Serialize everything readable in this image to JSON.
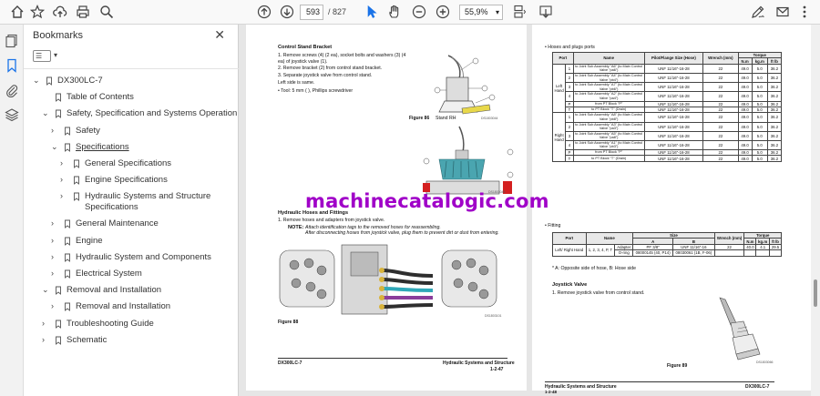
{
  "toolbar": {
    "current_page": "593",
    "total_pages": "/ 827",
    "zoom": "55,9%"
  },
  "bookmarks": {
    "title": "Bookmarks",
    "items": [
      {
        "label": "DX300LC-7",
        "indent": 0,
        "chev": "v"
      },
      {
        "label": "Table of Contents",
        "indent": 1,
        "chev": ""
      },
      {
        "label": "Safety, Specification and Systems Operation",
        "indent": 1,
        "chev": "v"
      },
      {
        "label": "Safety",
        "indent": 2,
        "chev": ">"
      },
      {
        "label": "Specifications",
        "indent": 2,
        "chev": "v",
        "selected": true
      },
      {
        "label": "General Specifications",
        "indent": 3,
        "chev": ">"
      },
      {
        "label": "Engine Specifications",
        "indent": 3,
        "chev": ">"
      },
      {
        "label": "Hydraulic Systems and Structure",
        "label2": "Specifications",
        "indent": 3,
        "chev": ">"
      },
      {
        "label": "General Maintenance",
        "indent": 2,
        "chev": ">"
      },
      {
        "label": "Engine",
        "indent": 2,
        "chev": ">"
      },
      {
        "label": "Hydraulic System and Components",
        "indent": 2,
        "chev": ">"
      },
      {
        "label": "Electrical System",
        "indent": 2,
        "chev": ">"
      },
      {
        "label": "Removal and Installation",
        "indent": 1,
        "chev": "v"
      },
      {
        "label": "Removal and Installation",
        "indent": 2,
        "chev": ">"
      },
      {
        "label": "Troubleshooting Guide",
        "indent": 1,
        "chev": ">"
      },
      {
        "label": "Schematic",
        "indent": 1,
        "chev": ">"
      }
    ]
  },
  "left_page": {
    "heading1": "Control Stand Bracket",
    "steps1": [
      "1.   Remove screws (4) (2 ea), socket bolts and washers (3) (4",
      "      ea) of joystick valve (1).",
      "2.   Remove bracket (2) from control stand bracket.",
      "3.   Separate joystick valve from control stand.",
      "      Left side is same.",
      "      •   Tool: 5 mm (         ), Phillips screwdriver"
    ],
    "fig86": "Figure 86",
    "fig86_title": "Stand RH",
    "fig86_code": "DS1803044",
    "fig87_code": "DS1803045",
    "heading2": "Hydraulic Hoses and Fittings",
    "step2": "1.   Remove hoses and adapters from joystick valve.",
    "note_label": "NOTE:",
    "note1": "Attach identification tags to the removed hoses for reassembling.",
    "note2": "After disconnecting hoses from joystick valve, plug them to prevent dirt or dust from entering.",
    "fig88": "Figure 88",
    "fig88_code": "DS1803101",
    "footer_left": "DX300LC-7",
    "footer_right1": "Hydraulic Systems and Structure",
    "footer_right2": "1-2-47"
  },
  "right_page": {
    "heading1": "•    Hoses and plugs ports",
    "table1_headers": [
      "Port",
      "Name",
      "Pilot/Flange Size (Hose)",
      "Wrench (mm)",
      "N.m",
      "kg.m",
      "ft lb"
    ],
    "table1_torque": "Torque",
    "table1_left": "Left Hand",
    "table1_right": "Right Hand",
    "table1_rows": [
      [
        "1",
        "to Joint Sub Assembly \"A6\" (to Main Control Valve \"pa6\")",
        "UNF 11/16\"-16-28",
        "22",
        "49.0",
        "5.0",
        "36.2"
      ],
      [
        "2",
        "to Joint Sub Assembly \"A4\" (to Main Control Valve \"pb4\")",
        "UNF 11/16\"-16-28",
        "22",
        "49.0",
        "5.0",
        "36.2"
      ],
      [
        "3",
        "to Joint Sub Assembly \"A7\" (to Main Control Valve \"pb6\")",
        "UNF 11/16\"-16-28",
        "22",
        "49.0",
        "5.0",
        "36.2"
      ],
      [
        "4",
        "to Joint Sub Assembly \"A2\" (to Main Control Valve \"pa4\")",
        "UNF 11/16\"-16-28",
        "22",
        "49.0",
        "5.0",
        "36.2"
      ],
      [
        "P",
        "from PT Block \"P\"",
        "UNF 11/16\"-16-28",
        "22",
        "49.0",
        "5.0",
        "36.2"
      ],
      [
        "T",
        "to PT Block \"T\" (Drain)",
        "UNF 11/16\"-16-28",
        "22",
        "49.0",
        "5.0",
        "36.2"
      ],
      [
        "1",
        "to Joint Sub Assembly \"A8\" (to Main Control Valve \"pb8\")",
        "UNF 11/16\"-16-28",
        "22",
        "49.0",
        "5.0",
        "36.2"
      ],
      [
        "2",
        "to Joint Sub Assembly \"A3\" (to Main Control Valve \"pa3\")",
        "UNF 11/16\"-16-28",
        "22",
        "49.0",
        "5.0",
        "36.2"
      ],
      [
        "3",
        "to Joint Sub Assembly \"A5\" (to Main Control Valve \"pa8\")",
        "UNF 11/16\"-16-28",
        "22",
        "49.0",
        "5.0",
        "36.2"
      ],
      [
        "4",
        "to Joint Sub Assembly \"A1\" (to Main Control Valve \"pb3\")",
        "UNF 11/16\"-16-28",
        "22",
        "49.0",
        "5.0",
        "36.2"
      ],
      [
        "P",
        "from PT Block \"P\"",
        "UNF 11/16\"-16-28",
        "22",
        "49.0",
        "5.0",
        "36.2"
      ],
      [
        "T",
        "to PT Block \"T\" (Drain)",
        "UNF 11/16\"-16-28",
        "22",
        "49.0",
        "5.0",
        "36.2"
      ]
    ],
    "heading2": "•    Fitting",
    "table2_headers": [
      "Port",
      "Name",
      "Size",
      "A",
      "B",
      "Wrench (mm)",
      "Torque",
      "N.m",
      "kg.m",
      "ft lb"
    ],
    "table2_portcell": "Left/ Right Hand",
    "table2_ports": "1, 2, 3, 4, P, T",
    "table2_rows": [
      [
        "Adapter",
        "PF 3/8\"",
        "UNF 11/16\"-16",
        "22",
        "40.0",
        "4.1",
        "29.5"
      ],
      [
        "O-ring",
        "08000145 (40, P14)",
        "08030061 (1B, F-06)",
        "",
        "",
        "",
        ""
      ]
    ],
    "table_note": "* A: Opposite side of hose, B: Hose side",
    "heading3": "Joystick Valve",
    "step3": "1.   Remove joystick valve from control stand.",
    "fig89": "Figure 89",
    "fig89_code": "DS1803066",
    "footer_left1": "Hydraulic Systems and Structure",
    "footer_left2": "1-2-48",
    "footer_right": "DX300LC-7"
  },
  "watermark": "machinecatalogic.com"
}
